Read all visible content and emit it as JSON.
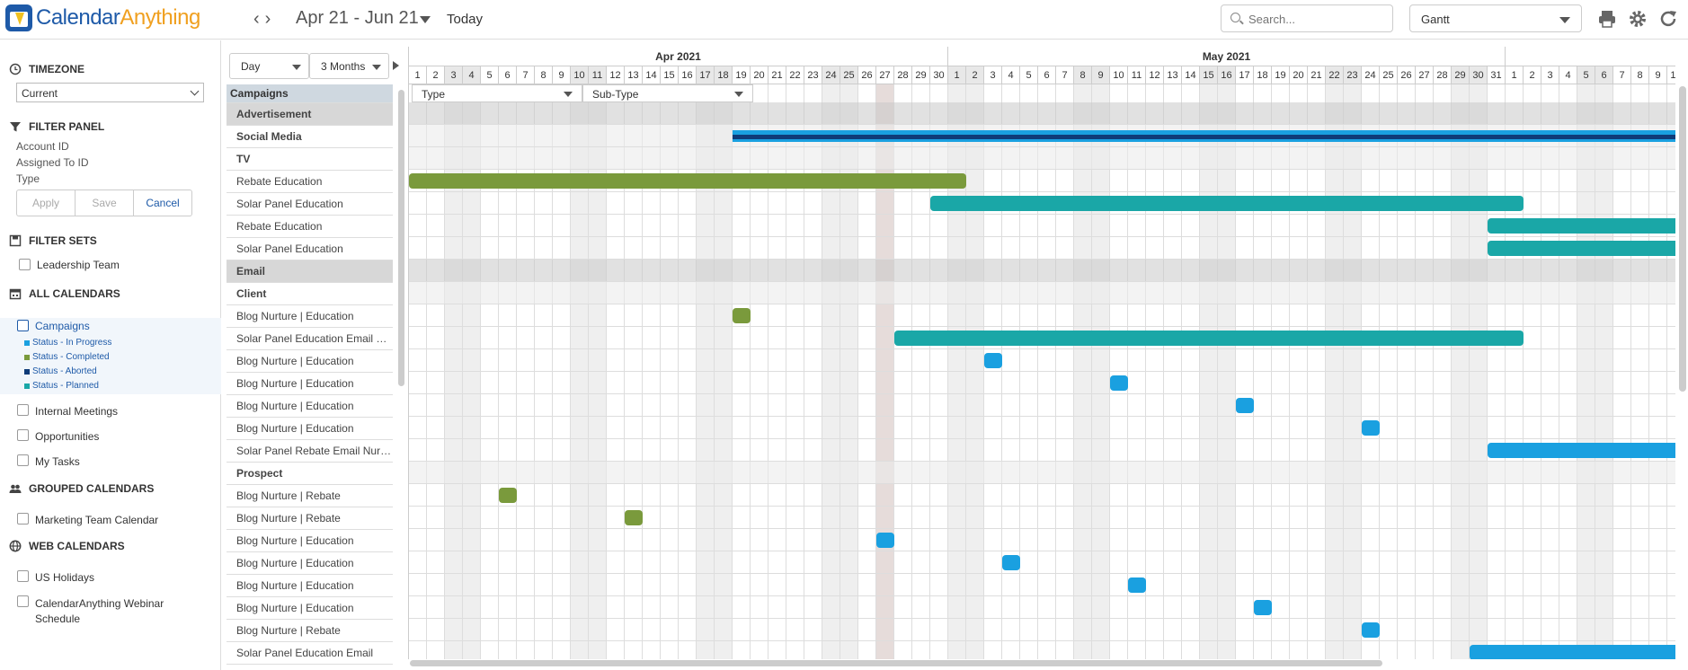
{
  "app": {
    "name_part1": "Calendar",
    "name_part2": "Anything"
  },
  "toolbar": {
    "date_range": "Apr 21 - Jun 21",
    "today_label": "Today",
    "search_placeholder": "Search...",
    "view_selected": "Gantt"
  },
  "sidebar": {
    "timezone": {
      "heading": "TIMEZONE",
      "selected": "Current"
    },
    "filter_panel": {
      "heading": "FILTER PANEL",
      "fields": [
        "Account ID",
        "Assigned To ID",
        "Type"
      ],
      "apply": "Apply",
      "save": "Save",
      "cancel": "Cancel"
    },
    "filter_sets": {
      "heading": "FILTER SETS",
      "items": [
        "Leadership Team"
      ]
    },
    "all_calendars": {
      "heading": "ALL CALENDARS",
      "campaigns": "Campaigns",
      "statuses": [
        {
          "label": "Status - In Progress",
          "color": "#1aa0e0"
        },
        {
          "label": "Status - Completed",
          "color": "#7a9a3c"
        },
        {
          "label": "Status - Aborted",
          "color": "#0f3b78"
        },
        {
          "label": "Status - Planned",
          "color": "#1aa7a7"
        }
      ],
      "others": [
        "Internal Meetings",
        "Opportunities",
        "My Tasks"
      ]
    },
    "grouped_calendars": {
      "heading": "GROUPED CALENDARS",
      "items": [
        "Marketing Team Calendar"
      ]
    },
    "web_calendars": {
      "heading": "WEB CALENDARS",
      "items": [
        "US Holidays",
        "CalendarAnything Webinar Schedule"
      ]
    }
  },
  "gantt": {
    "scale_select": "Day",
    "range_select": "3 Months",
    "column_header": "Campaigns",
    "filter_type": "Type",
    "filter_subtype": "Sub-Type",
    "months": [
      {
        "label": "Apr 2021",
        "days": 30
      },
      {
        "label": "May 2021",
        "days": 31
      },
      {
        "label": "",
        "days": 10
      }
    ],
    "rows": [
      {
        "label": "Advertisement",
        "kind": "group"
      },
      {
        "label": "Social Media",
        "kind": "sub"
      },
      {
        "label": "TV",
        "kind": "sub"
      },
      {
        "label": "Rebate Education",
        "kind": "leaf"
      },
      {
        "label": "Solar Panel Education",
        "kind": "leaf"
      },
      {
        "label": "Rebate Education",
        "kind": "leaf"
      },
      {
        "label": "Solar Panel Education",
        "kind": "leaf"
      },
      {
        "label": "Email",
        "kind": "group"
      },
      {
        "label": "Client",
        "kind": "sub"
      },
      {
        "label": "Blog Nurture | Education",
        "kind": "leaf"
      },
      {
        "label": "Solar Panel Education Email Nurture",
        "kind": "leaf"
      },
      {
        "label": "Blog Nurture | Education",
        "kind": "leaf"
      },
      {
        "label": "Blog Nurture | Education",
        "kind": "leaf"
      },
      {
        "label": "Blog Nurture | Education",
        "kind": "leaf"
      },
      {
        "label": "Blog Nurture | Education",
        "kind": "leaf"
      },
      {
        "label": "Solar Panel Rebate Email Nurture",
        "kind": "leaf"
      },
      {
        "label": "Prospect",
        "kind": "sub"
      },
      {
        "label": "Blog Nurture | Rebate",
        "kind": "leaf"
      },
      {
        "label": "Blog Nurture | Rebate",
        "kind": "leaf"
      },
      {
        "label": "Blog Nurture | Education",
        "kind": "leaf"
      },
      {
        "label": "Blog Nurture | Education",
        "kind": "leaf"
      },
      {
        "label": "Blog Nurture | Education",
        "kind": "leaf"
      },
      {
        "label": "Blog Nurture | Education",
        "kind": "leaf"
      },
      {
        "label": "Blog Nurture | Rebate",
        "kind": "leaf"
      },
      {
        "label": "Solar Panel Education Email",
        "kind": "leaf"
      }
    ],
    "bars": [
      {
        "row": 1,
        "start": 19,
        "end": 91,
        "status": "aborted"
      },
      {
        "row": 3,
        "start": 1,
        "end": 31,
        "status": "completed"
      },
      {
        "row": 4,
        "start": 30,
        "end": 62,
        "status": "planned"
      },
      {
        "row": 5,
        "start": 61,
        "end": 91,
        "status": "planned"
      },
      {
        "row": 6,
        "start": 61,
        "end": 91,
        "status": "planned"
      },
      {
        "row": 9,
        "start": 19,
        "end": 19,
        "status": "completed"
      },
      {
        "row": 10,
        "start": 28,
        "end": 62,
        "status": "planned"
      },
      {
        "row": 11,
        "start": 33,
        "end": 33,
        "status": "in_progress"
      },
      {
        "row": 12,
        "start": 40,
        "end": 40,
        "status": "in_progress"
      },
      {
        "row": 13,
        "start": 47,
        "end": 47,
        "status": "in_progress"
      },
      {
        "row": 14,
        "start": 54,
        "end": 54,
        "status": "in_progress"
      },
      {
        "row": 15,
        "start": 61,
        "end": 91,
        "status": "in_progress"
      },
      {
        "row": 17,
        "start": 6,
        "end": 6,
        "status": "completed"
      },
      {
        "row": 18,
        "start": 13,
        "end": 13,
        "status": "completed"
      },
      {
        "row": 19,
        "start": 27,
        "end": 27,
        "status": "in_progress"
      },
      {
        "row": 20,
        "start": 34,
        "end": 34,
        "status": "in_progress"
      },
      {
        "row": 21,
        "start": 41,
        "end": 41,
        "status": "in_progress"
      },
      {
        "row": 22,
        "start": 48,
        "end": 48,
        "status": "in_progress"
      },
      {
        "row": 23,
        "start": 54,
        "end": 54,
        "status": "in_progress"
      },
      {
        "row": 24,
        "start": 60,
        "end": 91,
        "status": "in_progress"
      }
    ],
    "colors": {
      "in_progress": "#1aa0e0",
      "completed": "#7a9a3c",
      "aborted": "#0f3b78",
      "planned": "#1aa7a7"
    }
  }
}
